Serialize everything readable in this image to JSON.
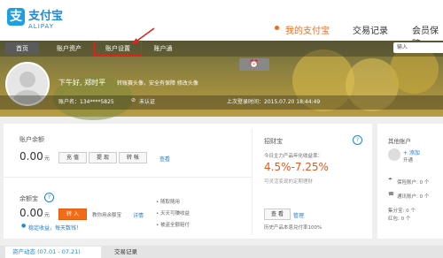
{
  "header": {
    "logo_text": "支付宝",
    "logo_sub": "ALIPAY",
    "logo_mark": "支",
    "nav": {
      "mine": "我的支付宝",
      "trades": "交易记录",
      "member": "会员保障"
    }
  },
  "subnav": {
    "tabs": [
      "首页",
      "账户资产",
      "账户设置",
      "账户通"
    ],
    "search_placeholder": "输入"
  },
  "profile": {
    "greeting": "下午好, 郑时平",
    "greeting_sub": "转账赛头像，安全有保障 修改头像",
    "account_label": "账户名：134****5825",
    "verify": "未认证",
    "last_login": "上次登录时间：2015.07.20 18:44:49"
  },
  "balance": {
    "label": "账户余额",
    "amount": "0.00",
    "unit": "元",
    "recharge": "充 值",
    "withdraw": "提 现",
    "transfer": "转 帐",
    "view": "查看"
  },
  "yuebao": {
    "label": "余额宝",
    "amount": "0.00",
    "unit": "元",
    "transfer_in": "转 入",
    "desc": "教你用余额宝",
    "detail": "详情",
    "promo": "稳定收益，每天数钱！",
    "features": [
      "随取随用",
      "天天可赚收益",
      "被盗全额赔付"
    ]
  },
  "zhaocaibao": {
    "label": "招财宝",
    "desc": "今日主力产品年化收益率：",
    "rate": "4.5%-7.25%",
    "note": "可灵活变现的定期理财",
    "view": "查 看",
    "manage": "管理",
    "history": "历史产品本息兑付率100%"
  },
  "side": {
    "title": "其他账户",
    "add": "+ 添加",
    "open": "开通",
    "insurance": "保险账户: 0 个",
    "telecom": "通讯账户: 0 个",
    "jifen": "集分宝: 0 个",
    "hongbao": "红包: 0 个"
  },
  "bottom_tabs": {
    "assets": "资产动态 (07.01 - 07.21)",
    "trades": "交易记录"
  },
  "colors": {
    "brand": "#1e88d0",
    "accent": "#f26b16",
    "rate": "#e85a1c"
  },
  "icons": {
    "help": "question-icon",
    "alarm": "alarm-icon"
  }
}
